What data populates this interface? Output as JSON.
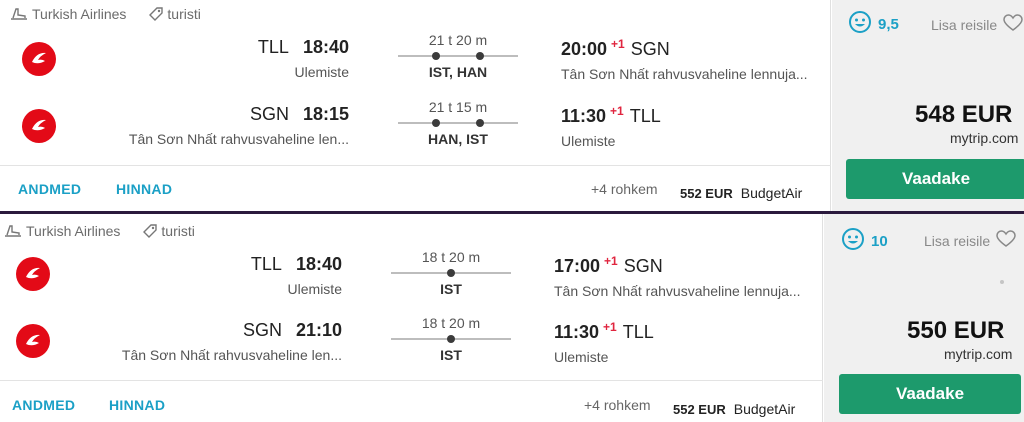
{
  "colors": {
    "accent": "#1ba0c6",
    "cta": "#1d9a6c",
    "nextday": "#e0253f",
    "logo": "#e30a17",
    "divider": "#2b1a3d"
  },
  "results": [
    {
      "airline": "Turkish Airlines",
      "fare_class": "turisti",
      "legs": [
        {
          "dep_code": "TLL",
          "dep_time": "18:40",
          "dep_airport": "Ulemiste",
          "duration": "21 t 20 m",
          "stops": "IST, HAN",
          "arr_time": "20:00",
          "plus_day": "+1",
          "arr_code": "SGN",
          "arr_airport": "Tân Sơn Nhất rahvusvaheline lennuja..."
        },
        {
          "dep_code": "SGN",
          "dep_time": "18:15",
          "dep_airport": "Tân Sơn Nhất rahvusvaheline len...",
          "duration": "21 t 15 m",
          "stops": "HAN, IST",
          "arr_time": "11:30",
          "plus_day": "+1",
          "arr_code": "TLL",
          "arr_airport": "Ulemiste"
        }
      ],
      "links": {
        "details": "ANDMED",
        "prices": "HINNAD"
      },
      "more": "+4 rohkem",
      "alt_price": "552 EUR",
      "alt_seller": "BudgetAir",
      "score": "9,5",
      "favorite_label": "Lisa reisile",
      "price": "548 EUR",
      "seller": "mytrip.com",
      "cta": "Vaadake"
    },
    {
      "airline": "Turkish Airlines",
      "fare_class": "turisti",
      "legs": [
        {
          "dep_code": "TLL",
          "dep_time": "18:40",
          "dep_airport": "Ulemiste",
          "duration": "18 t 20 m",
          "stops": "IST",
          "arr_time": "17:00",
          "plus_day": "+1",
          "arr_code": "SGN",
          "arr_airport": "Tân Sơn Nhất rahvusvaheline lennuja..."
        },
        {
          "dep_code": "SGN",
          "dep_time": "21:10",
          "dep_airport": "Tân Sơn Nhất rahvusvaheline len...",
          "duration": "18 t 20 m",
          "stops": "IST",
          "arr_time": "11:30",
          "plus_day": "+1",
          "arr_code": "TLL",
          "arr_airport": "Ulemiste"
        }
      ],
      "links": {
        "details": "ANDMED",
        "prices": "HINNAD"
      },
      "more": "+4 rohkem",
      "alt_price": "552 EUR",
      "alt_seller": "BudgetAir",
      "score": "10",
      "favorite_label": "Lisa reisile",
      "price": "550 EUR",
      "seller": "mytrip.com",
      "cta": "Vaadake"
    }
  ]
}
